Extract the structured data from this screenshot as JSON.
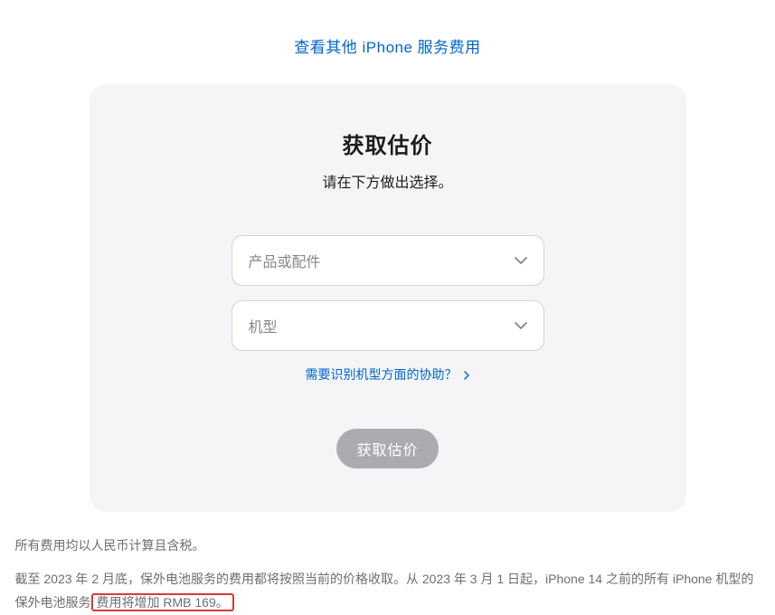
{
  "topLink": {
    "label": "查看其他 iPhone 服务费用"
  },
  "card": {
    "title": "获取估价",
    "subtitle": "请在下方做出选择。",
    "select1": {
      "placeholder": "产品或配件"
    },
    "select2": {
      "placeholder": "机型"
    },
    "helpLink": "需要识别机型方面的协助？",
    "submitLabel": "获取估价"
  },
  "footer": {
    "line1": "所有费用均以人民币计算且含税。",
    "line2_pre": "截至 2023 年 2 月底，保外电池服务的费用都将按照当前的价格收取。从 2023 年 3 月 1 日起，iPhone 14 之前的所有 iPhone 机型的保外电池服务",
    "line2_highlight": "费用将增加 RMB 169。"
  }
}
